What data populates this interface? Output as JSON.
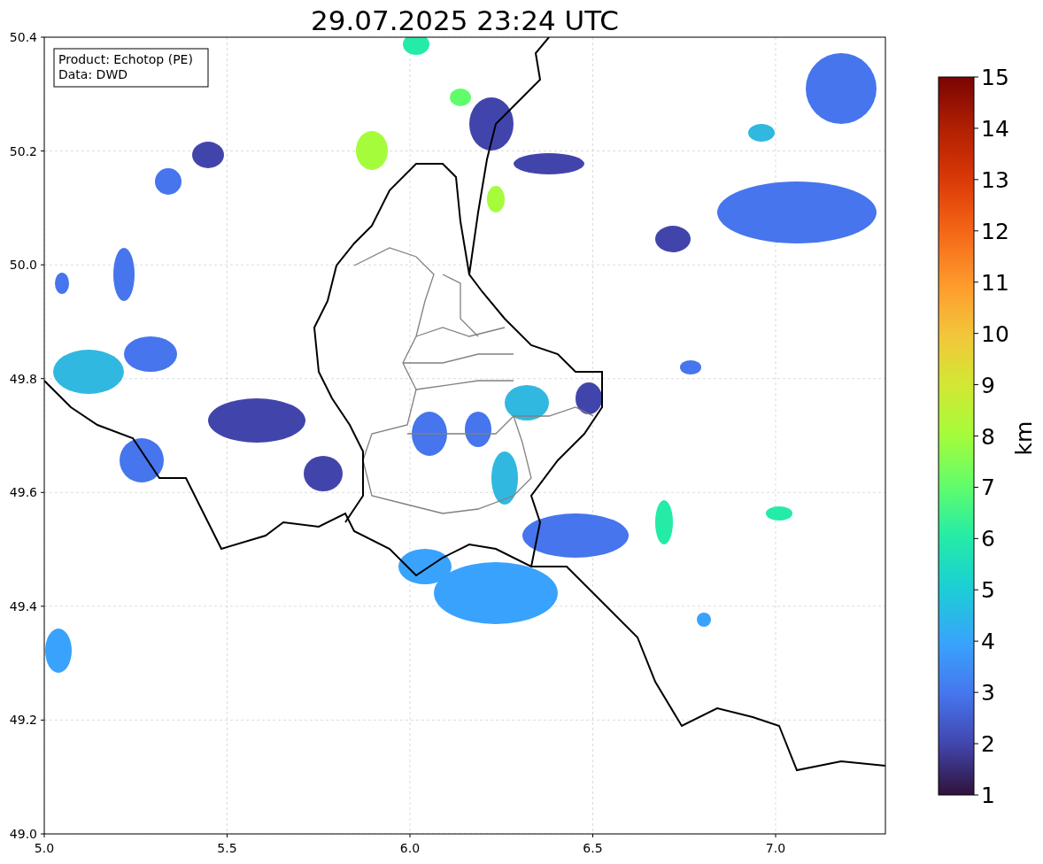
{
  "title": "29.07.2025 23:24 UTC",
  "info_box": [
    "Product: Echotop (PE)",
    "Data: DWD"
  ],
  "map": {
    "x_ticks": [
      "5.0",
      "5.5",
      "6.0",
      "6.5",
      "7.0"
    ],
    "y_ticks": [
      "50.4",
      "50.2",
      "50.0",
      "49.8",
      "49.6",
      "49.4",
      "49.2",
      "49.0"
    ]
  },
  "colorbar": {
    "ticks": [
      "15",
      "14",
      "13",
      "12",
      "11",
      "10",
      "9",
      "8",
      "7",
      "6",
      "5",
      "4",
      "3",
      "2",
      "1"
    ],
    "label": "km"
  }
}
